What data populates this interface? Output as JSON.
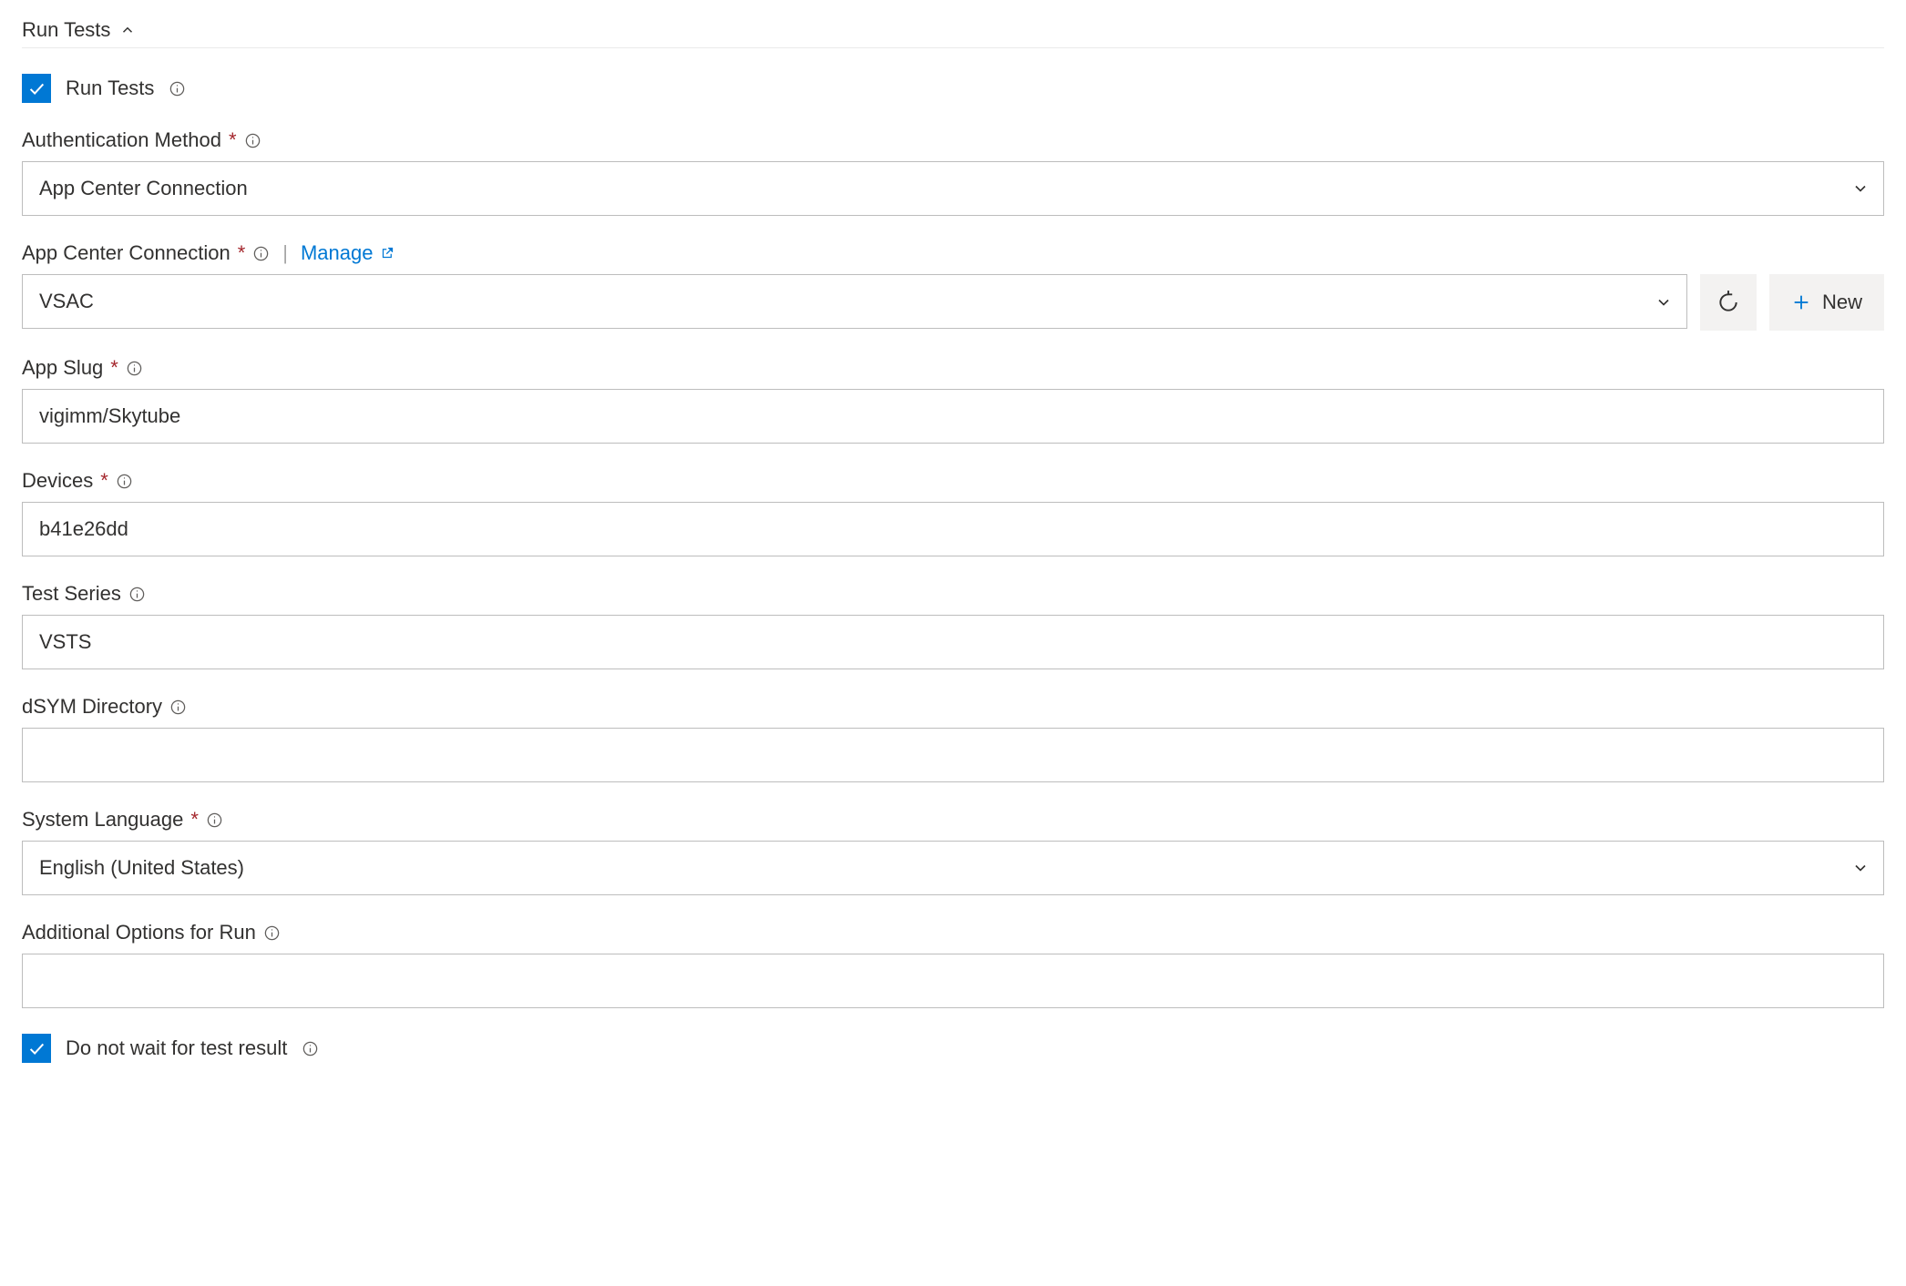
{
  "section": {
    "title": "Run Tests"
  },
  "fields": {
    "runTests": {
      "label": "Run Tests",
      "checked": true
    },
    "authMethod": {
      "label": "Authentication Method",
      "required": true,
      "value": "App Center Connection"
    },
    "appCenterConnection": {
      "label": "App Center Connection",
      "required": true,
      "manageLabel": "Manage",
      "value": "VSAC",
      "newLabel": "New"
    },
    "appSlug": {
      "label": "App Slug",
      "required": true,
      "value": "vigimm/Skytube"
    },
    "devices": {
      "label": "Devices",
      "required": true,
      "value": "b41e26dd"
    },
    "testSeries": {
      "label": "Test Series",
      "required": false,
      "value": "VSTS"
    },
    "dsymDirectory": {
      "label": "dSYM Directory",
      "required": false,
      "value": ""
    },
    "systemLanguage": {
      "label": "System Language",
      "required": true,
      "value": "English (United States)"
    },
    "additionalOptions": {
      "label": "Additional Options for Run",
      "required": false,
      "value": ""
    },
    "doNotWait": {
      "label": "Do not wait for test result",
      "checked": true
    }
  }
}
